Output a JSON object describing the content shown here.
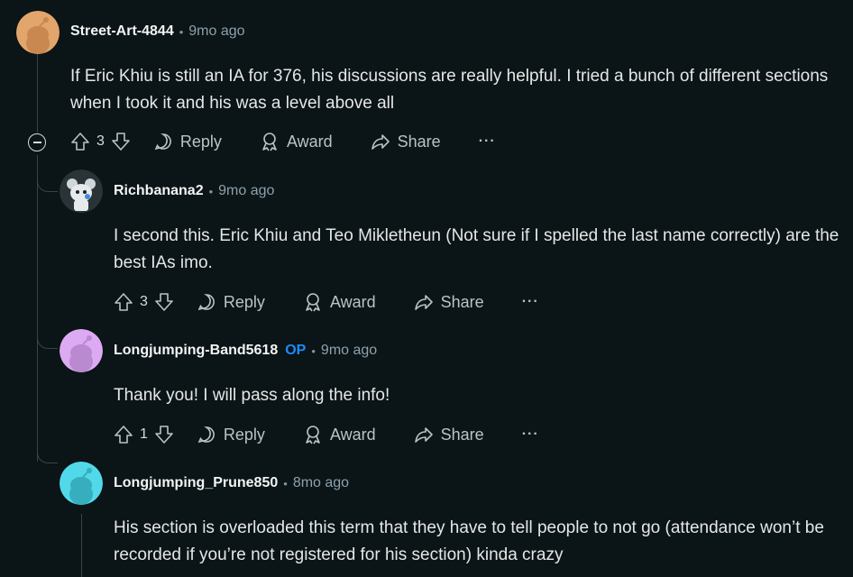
{
  "comments": [
    {
      "author": "Street-Art-4844",
      "time": "9mo ago",
      "avatar_color": "#d99a61",
      "body": "If Eric Khiu is still an IA for 376, his discussions are really helpful. I tried a bunch of different sections when I took it and his was a level above all",
      "votes": "3"
    },
    {
      "author": "Richbanana2",
      "time": "9mo ago",
      "avatar_color": "#2a3337",
      "body": "I second this. Eric Khiu and Teo Mikletheun (Not sure if I spelled the last name correctly) are the best IAs imo.",
      "votes": "3"
    },
    {
      "author": "Longjumping-Band5618",
      "op_label": "OP",
      "time": "9mo ago",
      "avatar_color": "#d8a9f0",
      "body": "Thank you! I will pass along the info!",
      "votes": "1"
    },
    {
      "author": "Longjumping_Prune850",
      "time": "8mo ago",
      "avatar_color": "#4dd6e6",
      "body": "His section is overloaded this term that they have to tell people to not go (attendance won’t be recorded if you’re not registered for his section) kinda crazy"
    }
  ],
  "actions": {
    "reply": "Reply",
    "award": "Award",
    "share": "Share",
    "more": "···"
  },
  "separator": "•"
}
